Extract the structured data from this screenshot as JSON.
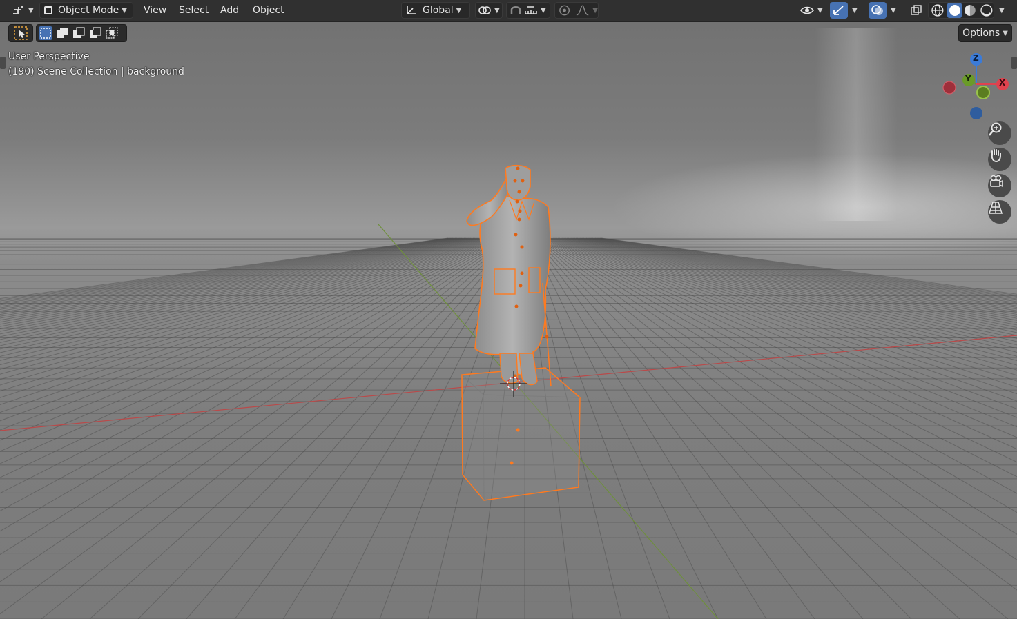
{
  "header": {
    "editor_type_icon": "editor-type-icon",
    "mode_label": "Object Mode",
    "menus": [
      "View",
      "Select",
      "Add",
      "Object"
    ],
    "transform_orientation": "Global",
    "pivot_icon": "pivot-point-icon",
    "snap_icon": "snap-magnet-icon",
    "snap_target_icon": "snap-increment-icon",
    "proportional_icon": "proportional-edit-icon",
    "falloff_icon": "falloff-curve-icon",
    "visibility_icon": "eye-icon",
    "gizmo_icon": "gizmo-icon",
    "overlay_icon": "overlay-icon",
    "xray_icon": "xray-icon",
    "shading_modes": [
      "wireframe-shading-icon",
      "solid-shading-icon",
      "material-shading-icon",
      "rendered-shading-icon"
    ]
  },
  "toolbar": {
    "select_tool_icon": "select-cursor-icon",
    "select_modes": [
      "select-new-icon",
      "select-extend-icon",
      "select-subtract-icon",
      "select-invert-icon",
      "select-intersect-icon"
    ],
    "options_label": "Options"
  },
  "viewport": {
    "view_name": "User Perspective",
    "collection_info": "(190) Scene Collection | background"
  },
  "gizmo": {
    "z_label": "Z",
    "y_label": "Y",
    "x_label": "X",
    "colors": {
      "x": "#e0424e",
      "y": "#6a9b28",
      "z": "#3b7bd8"
    }
  },
  "navigation": [
    "zoom-icon",
    "pan-hand-icon",
    "camera-view-icon",
    "orthographic-grid-icon"
  ],
  "colors": {
    "selection": "#ff7a1f",
    "active_blue": "#4772b3"
  }
}
